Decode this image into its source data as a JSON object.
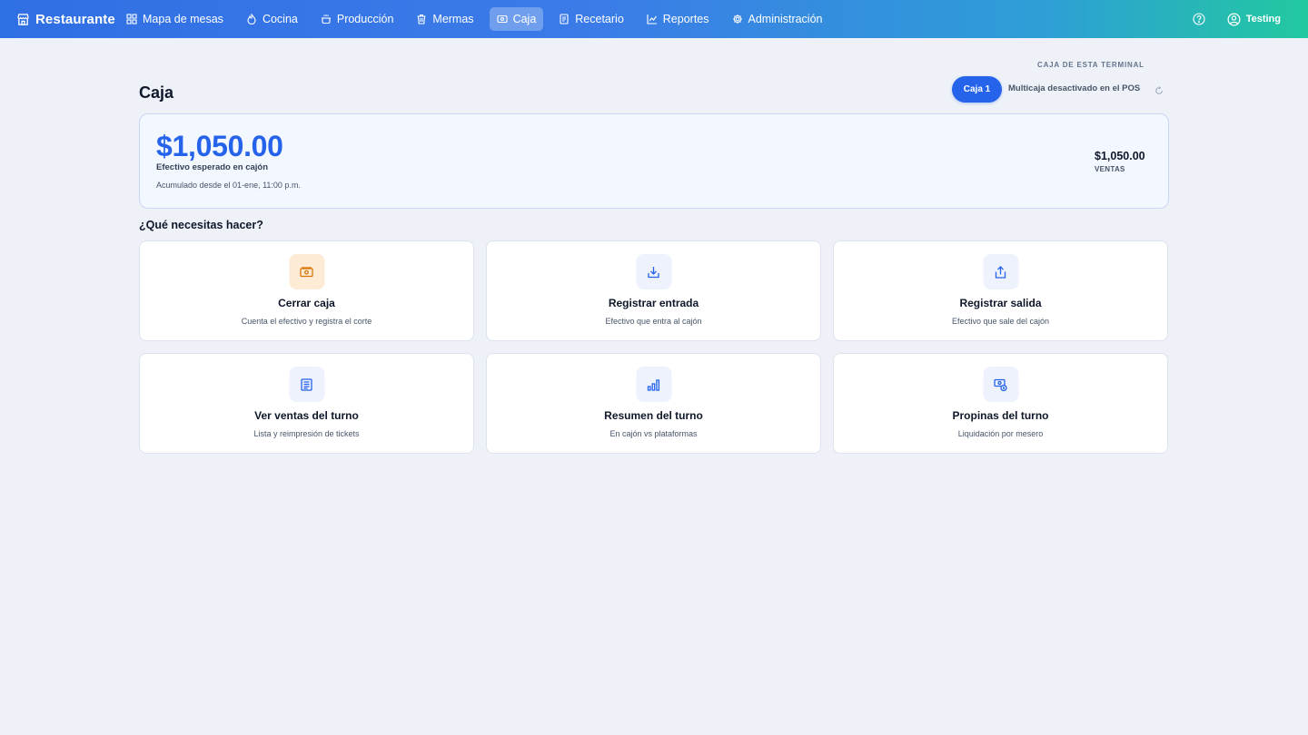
{
  "app": {
    "title": "Restaurante"
  },
  "nav": {
    "items": [
      {
        "label": "Mapa de mesas",
        "icon": "grid-icon"
      },
      {
        "label": "Cocina",
        "icon": "flame-icon"
      },
      {
        "label": "Producción",
        "icon": "pot-icon"
      },
      {
        "label": "Mermas",
        "icon": "trash-icon"
      },
      {
        "label": "Caja",
        "icon": "cash-register-icon",
        "active": true
      },
      {
        "label": "Recetario",
        "icon": "recipe-book-icon"
      },
      {
        "label": "Reportes",
        "icon": "line-chart-icon"
      },
      {
        "label": "Administración",
        "icon": "gear-icon"
      }
    ]
  },
  "user": {
    "name": "Testing",
    "help_icon": "help-circle-icon",
    "avatar_icon": "user-circle-icon"
  },
  "page": {
    "title": "Caja"
  },
  "terminal": {
    "label": "CAJA DE ESTA TERMINAL",
    "selected": "Caja 1",
    "note": "Multicaja desactivado en el POS"
  },
  "summary": {
    "amount": "$1,050.00",
    "amount_label": "Efectivo esperado en cajón",
    "since": "Acumulado desde el 01-ene, 11:00 p.m.",
    "sales_value": "$1,050.00",
    "sales_label": "VENTAS"
  },
  "actions": {
    "heading": "¿Qué necesitas hacer?",
    "items": [
      {
        "title": "Cerrar caja",
        "desc": "Cuenta el efectivo y registra el corte",
        "icon": "cash-icon"
      },
      {
        "title": "Registrar entrada",
        "desc": "Efectivo que entra al cajón",
        "icon": "download-icon"
      },
      {
        "title": "Registrar salida",
        "desc": "Efectivo que sale del cajón",
        "icon": "upload-icon"
      },
      {
        "title": "Ver ventas del turno",
        "desc": "Lista y reimpresión de tickets",
        "icon": "receipt-list-icon"
      },
      {
        "title": "Resumen del turno",
        "desc": "En cajón vs plataformas",
        "icon": "bar-chart-icon"
      },
      {
        "title": "Propinas del turno",
        "desc": "Liquidación por mesero",
        "icon": "tip-money-icon"
      }
    ]
  },
  "colors": {
    "accent": "#2563eb",
    "background": "#eef2f8",
    "warm_icon_bg": "#fdebd6",
    "warm_icon": "#d97706"
  }
}
